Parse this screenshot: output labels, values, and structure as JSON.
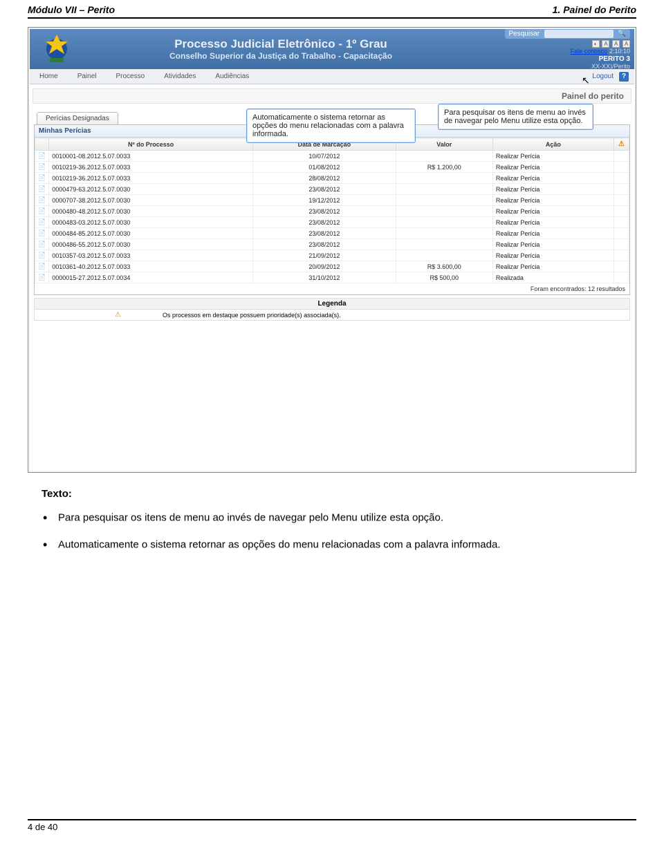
{
  "doc": {
    "header_left": "Módulo VII – Perito",
    "header_right": "1. Painel do Perito",
    "footer": "4 de 40"
  },
  "banner": {
    "title": "Processo Judicial Eletrônico - 1º Grau",
    "subtitle": "Conselho Superior da Justiça do Trabalho - Capacitação",
    "search_label": "Pesquisar",
    "fale": "Fale conosco",
    "time": "2:10:10",
    "perito": "PERITO 3",
    "perito_sub": "XX-XX)/Perito"
  },
  "nav": {
    "items": [
      "Home",
      "Painel",
      "Processo",
      "Atividades",
      "Audiências"
    ],
    "logout": "Logout"
  },
  "callouts": {
    "left": "Automaticamente o sistema retornar as opções do menu relacionadas com a palavra informada.",
    "right": "Para pesquisar os itens de menu ao invés de navegar pelo Menu utilize esta opção."
  },
  "panel": {
    "title": "Painel do perito",
    "tab": "Perícias Designadas",
    "sub": "Minhas Perícias",
    "columns": {
      "processo": "Nº do Processo",
      "data": "Data de Marcação",
      "valor": "Valor",
      "acao": "Ação"
    },
    "rows": [
      {
        "proc": "0010001-08.2012.5.07.0033",
        "data": "10/07/2012",
        "valor": "",
        "acao": "Realizar Perícia"
      },
      {
        "proc": "0010219-36.2012.5.07.0033",
        "data": "01/08/2012",
        "valor": "R$ 1.200,00",
        "acao": "Realizar Perícia"
      },
      {
        "proc": "0010219-36.2012.5.07.0033",
        "data": "28/08/2012",
        "valor": "",
        "acao": "Realizar Perícia"
      },
      {
        "proc": "0000479-63.2012.5.07.0030",
        "data": "23/08/2012",
        "valor": "",
        "acao": "Realizar Perícia"
      },
      {
        "proc": "0000707-38.2012.5.07.0030",
        "data": "19/12/2012",
        "valor": "",
        "acao": "Realizar Perícia"
      },
      {
        "proc": "0000480-48.2012.5.07.0030",
        "data": "23/08/2012",
        "valor": "",
        "acao": "Realizar Perícia"
      },
      {
        "proc": "0000483-03.2012.5.07.0030",
        "data": "23/08/2012",
        "valor": "",
        "acao": "Realizar Perícia"
      },
      {
        "proc": "0000484-85.2012.5.07.0030",
        "data": "23/08/2012",
        "valor": "",
        "acao": "Realizar Perícia"
      },
      {
        "proc": "0000486-55.2012.5.07.0030",
        "data": "23/08/2012",
        "valor": "",
        "acao": "Realizar Perícia"
      },
      {
        "proc": "0010357-03.2012.5.07.0033",
        "data": "21/09/2012",
        "valor": "",
        "acao": "Realizar Perícia"
      },
      {
        "proc": "0010361-40.2012.5.07.0033",
        "data": "20/09/2012",
        "valor": "R$ 3.600,00",
        "acao": "Realizar Perícia"
      },
      {
        "proc": "0000015-27.2012.5.07.0034",
        "data": "31/10/2012",
        "valor": "R$ 500,00",
        "acao": "Realizada"
      }
    ],
    "result_count": "Foram encontrados: 12 resultados",
    "legend_title": "Legenda",
    "legend_text": "Os processos em destaque possuem prioridade(s) associada(s)."
  },
  "body": {
    "label": "Texto:",
    "bullets": [
      "Para pesquisar os itens de menu ao invés de navegar pelo Menu utilize esta opção.",
      "Automaticamente o sistema retornar as opções do menu relacionadas com a palavra informada."
    ]
  }
}
